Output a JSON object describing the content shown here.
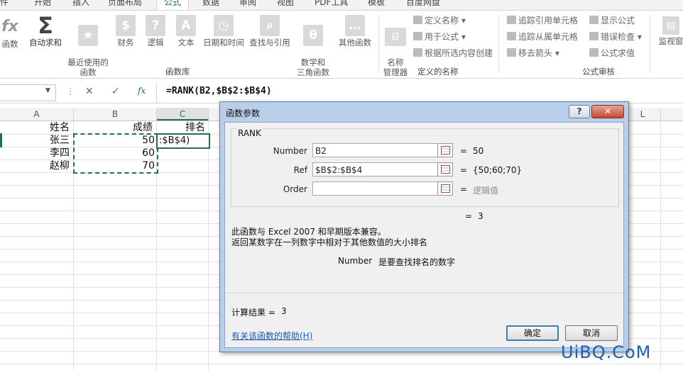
{
  "ribbon": {
    "tabs": [
      "件",
      "开始",
      "插入",
      "页面布局",
      "公式",
      "数据",
      "审阅",
      "视图",
      "PDF工具",
      "模板",
      "百度网盘"
    ],
    "active_tab": "公式",
    "function_buttons": [
      {
        "label": "函数",
        "icon": "fx"
      },
      {
        "label": "自动求和",
        "icon": "Σ"
      },
      {
        "label": "最近使用的\n函数",
        "icon": "★"
      },
      {
        "label": "财务",
        "icon": "$"
      },
      {
        "label": "逻辑",
        "icon": "?"
      },
      {
        "label": "文本",
        "icon": "A"
      },
      {
        "label": "日期和时间",
        "icon": "◷"
      },
      {
        "label": "查找与引用",
        "icon": "⌕"
      },
      {
        "label": "数学和\n三角函数",
        "icon": "θ"
      },
      {
        "label": "其他函数",
        "icon": "…"
      }
    ],
    "group_library": "函数库",
    "name_manager": "名称\n管理器",
    "define_name": "定义名称",
    "use_in_formula": "用于公式",
    "create_from_selection": "根据所选内容创建",
    "group_names": "定义的名称",
    "trace_precedents": "追踪引用单元格",
    "trace_dependents": "追踪从属单元格",
    "remove_arrows": "移去箭头",
    "show_formulas": "显示公式",
    "error_checking": "错误检查",
    "evaluate_formula": "公式求值",
    "group_audit": "公式审核",
    "watch_window": "监视窗"
  },
  "formula_bar": {
    "cancel": "✕",
    "enter": "✓",
    "fx": "fx",
    "content": "=RANK(B2,$B$2:$B$4)"
  },
  "sheet": {
    "columns": [
      "A",
      "B",
      "C",
      "L"
    ],
    "selected_column": "C",
    "header_row": {
      "name": "姓名",
      "score": "成绩",
      "rank": "排名"
    },
    "rows": [
      {
        "name": "张三",
        "score": "50"
      },
      {
        "name": "李四",
        "score": "60"
      },
      {
        "name": "赵柳",
        "score": "70"
      }
    ],
    "editing_cell_text": ":$B$4)"
  },
  "dialog": {
    "title": "函数参数",
    "help_btn": "?",
    "close_btn": "✕",
    "function_name": "RANK",
    "args": [
      {
        "label": "Number",
        "value": "B2",
        "result": "50"
      },
      {
        "label": "Ref",
        "value": "$B$2:$B$4",
        "result": "{50;60;70}"
      },
      {
        "label": "Order",
        "value": "",
        "result": "逻辑值"
      }
    ],
    "formula_result_inline": "3",
    "description_1": "此函数与 Excel 2007 和早期版本兼容。",
    "description_2": "返回某数字在一列数字中相对于其他数值的大小排名",
    "arg_help_name": "Number",
    "arg_help_text": "是要查找排名的数字",
    "calc_result_label": "计算结果 =",
    "calc_result_value": "3",
    "help_link": "有关该函数的帮助(H)",
    "ok": "确定",
    "cancel": "取消"
  },
  "watermark": "UiBQ.CoM",
  "colors": {
    "accent": "#217346",
    "dialog_frame": "#b9cee9",
    "link": "#1a58b6"
  }
}
